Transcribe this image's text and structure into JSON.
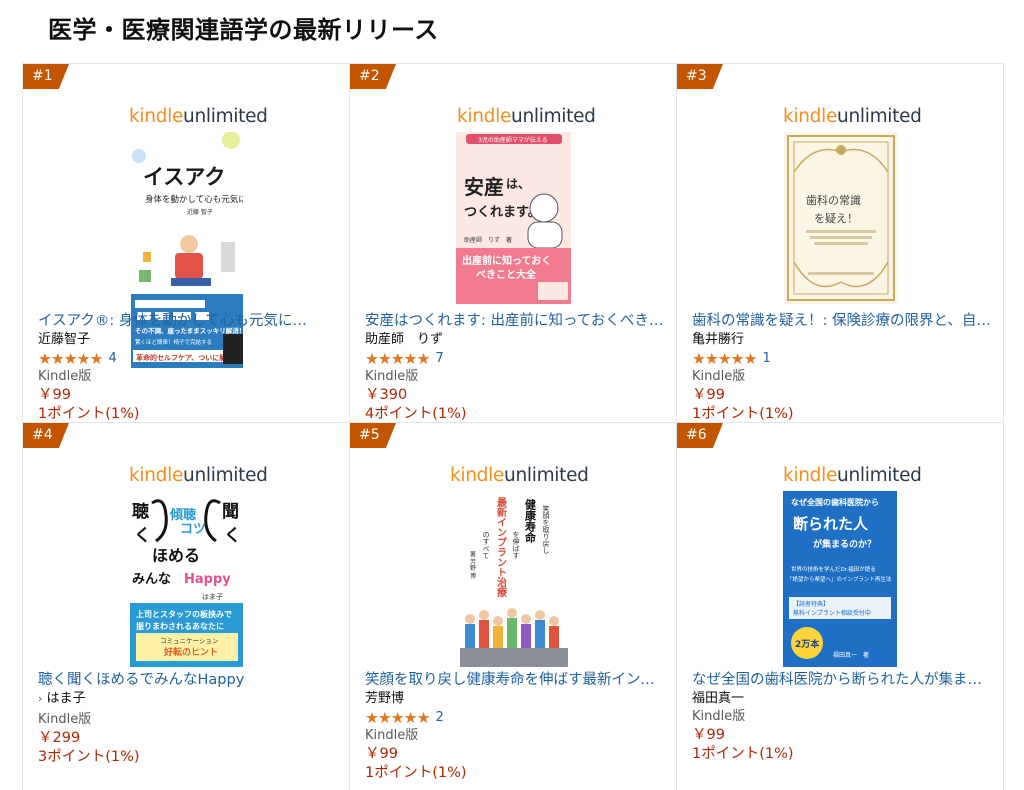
{
  "page": {
    "title": "医学・医療関連語学の最新リリース"
  },
  "ku": {
    "kindle": "kindle",
    "unlimited": "unlimited"
  },
  "items": [
    {
      "rank": "#1",
      "title": "イスアク®: 身体を動かして心も元気に…",
      "author": "近藤智子",
      "stars": "★★★★★",
      "rating_count": "4",
      "format": "Kindle版",
      "price": "￥99",
      "points": "1ポイント(1%)",
      "cover": {
        "main": "イスアク",
        "sub": "身体を動かして心も元気に",
        "author_small": "近藤 智子",
        "band1": "その不調、座ったままスッキリ解消！",
        "band2": "革命的セルフケア、ついに解禁"
      }
    },
    {
      "rank": "#2",
      "title": "安産はつくれます: 出産前に知っておくべき…",
      "author": "助産師　りず",
      "stars": "★★★★★",
      "rating_count": "7",
      "format": "Kindle版",
      "price": "￥390",
      "points": "4ポイント(1%)",
      "cover": {
        "top": "3児の助産師ママが伝える",
        "main1": "安産",
        "main2": "は、",
        "main3": "つくれます。",
        "author_small": "助産師　りず　著",
        "bottom1": "出産前に知っておく",
        "bottom2": "べきこと大全"
      }
    },
    {
      "rank": "#3",
      "title": "歯科の常識を疑え！: 保険診療の限界と、自…",
      "author": "亀井勝行",
      "stars": "★★★★★",
      "rating_count": "1",
      "format": "Kindle版",
      "price": "￥99",
      "points": "1ポイント(1%)",
      "cover": {
        "main1": "歯科の常識",
        "main2": "を疑え！"
      }
    },
    {
      "rank": "#4",
      "title": "聴く聞くほめるでみんなHappy",
      "author": "はま子",
      "author_prefix": "›",
      "stars": "",
      "rating_count": "",
      "format": "Kindle版",
      "price": "￥299",
      "points": "3ポイント(1%)",
      "cover": {
        "left": "聴く",
        "right": "聞く",
        "mid1": "傾聴",
        "mid2": "の",
        "mid3": "コツ",
        "mid4": "ほめる",
        "mid5": "で",
        "line2": "みんなHappy",
        "author_small": "はま子",
        "band1": "上司とスタッフの板挟みで",
        "band2": "振りまわされるあなたに",
        "band3": "コミュニケーション",
        "band4": "好転のヒント"
      }
    },
    {
      "rank": "#5",
      "title": "笑顔を取り戻し健康寿命を伸ばす最新インプ…",
      "author": "芳野博",
      "stars": "★★★★★",
      "rating_count": "2",
      "format": "Kindle版",
      "price": "￥99",
      "points": "1ポイント(1%)",
      "cover": {
        "col1": "笑顔を取り戻し",
        "col2": "健康寿命",
        "col3": "を伸ばす",
        "col4": "最新インプラント治療",
        "col5": "のすべて",
        "author_small": "著 芳野 博"
      }
    },
    {
      "rank": "#6",
      "title": "なぜ全国の歯科医院から断られた人が集まる…",
      "author": "福田真一",
      "stars": "",
      "rating_count": "",
      "format": "Kindle版",
      "price": "￥99",
      "points": "1ポイント(1%)",
      "cover": {
        "top": "なぜ全国の歯科医院から",
        "main": "断られた人",
        "sub": "が集まるのか？",
        "small1": "世界の技術を学んだDr.福田が語る",
        "small2": "「絶望から希望へ」のインプラント再生法",
        "box1": "【読者特典】",
        "box2": "無料インプラント相談受付中",
        "badge": "2万本",
        "author_small": "福田真一　著"
      }
    }
  ]
}
